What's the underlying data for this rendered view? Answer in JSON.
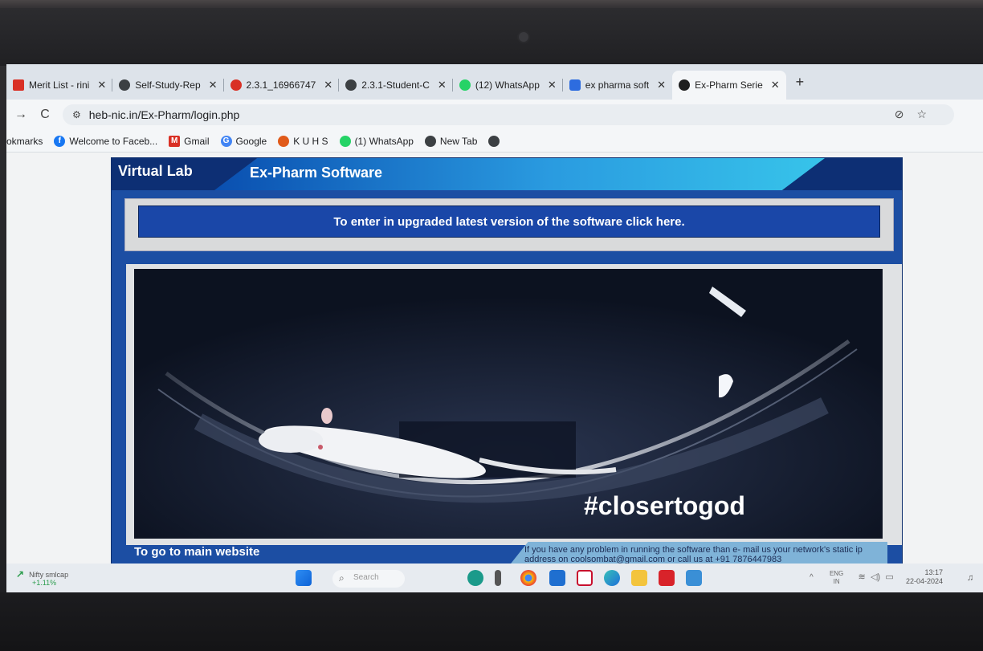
{
  "tabs": [
    {
      "title": "Merit List - rini",
      "icon": "gmail-icon",
      "color": "#d93025"
    },
    {
      "title": "Self-Study-Rep",
      "icon": "globe-icon",
      "color": "#3c4043"
    },
    {
      "title": "2.3.1_16966747",
      "icon": "pdf-icon",
      "color": "#d93025"
    },
    {
      "title": "2.3.1-Student-C",
      "icon": "globe-icon",
      "color": "#3c4043"
    },
    {
      "title": "(12) WhatsApp",
      "icon": "whatsapp-icon",
      "color": "#25d366"
    },
    {
      "title": "ex pharma soft",
      "icon": "yahoo-icon",
      "color": "#2d6cdf"
    },
    {
      "title": "Ex-Pharm Serie",
      "icon": "site-icon",
      "color": "#1f1f1f"
    }
  ],
  "url": "heb-nic.in/Ex-Pharm/login.php",
  "bookmarks": [
    {
      "label": "okmarks",
      "icon": ""
    },
    {
      "label": "Welcome to Faceb...",
      "icon": "facebook-icon",
      "color": "#1877f2"
    },
    {
      "label": "Gmail",
      "icon": "gmail-icon",
      "color": "#d93025"
    },
    {
      "label": "Google",
      "icon": "google-icon",
      "color": "#4285f4"
    },
    {
      "label": "K U H S",
      "icon": "kuhs-icon",
      "color": "#e05a1a"
    },
    {
      "label": "(1) WhatsApp",
      "icon": "whatsapp-icon",
      "color": "#25d366"
    },
    {
      "label": "New Tab",
      "icon": "globe-icon",
      "color": "#3c4043"
    }
  ],
  "page": {
    "brand": "Virtual Lab",
    "title": "Ex-Pharm Software",
    "notice": "To enter in upgraded latest version of the software click here.",
    "hashtag": "#closertogod",
    "footer_link": "To go to main website",
    "footer_note": "If you have any problem in running the software than e- mail us your network's static ip address on coolsombat@gmail.com or call us at +91 7876447983"
  },
  "taskbar": {
    "widget_name": "Nifty smlcap",
    "widget_value": "+1.11%",
    "search_placeholder": "Search",
    "lang": "ENG",
    "region": "IN",
    "time": "13:17",
    "date": "22-04-2024"
  }
}
